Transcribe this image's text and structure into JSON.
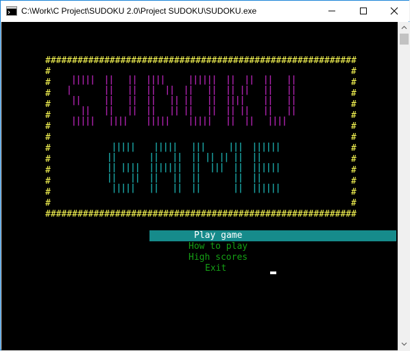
{
  "window": {
    "title": "C:\\Work\\C Project\\SUDOKU 2.0\\Project SUDOKU\\SUDOKU.exe",
    "icons": {
      "app": "console-app-icon",
      "minimize": "minimize-icon",
      "maximize": "maximize-icon",
      "close": "close-icon"
    }
  },
  "frame": {
    "top": "##########################################################",
    "bottom": "##########################################################",
    "side_char": "#",
    "side_count": 13
  },
  "art": {
    "sudoku": " |||||  ||   ||  ||||     ||||||  ||  ||  ||   ||\n|       ||   ||  ||  ||  ||   ||  || ||   ||   ||\n ||     ||   ||  ||   || ||   ||  ||||    ||   ||\n   ||   ||   ||  ||   || ||   ||  || ||   ||   ||\n |||||   ||||    |||||    |||||   ||  ||   ||||",
    "game": "  |||||    |||||   |||     |||  ||||||\n ||       ||   ||  || || || ||  ||\n || ||||  |||||||  ||  |||  ||  ||||||\n ||   ||  ||   ||  ||       ||  ||\n  |||||   ||   ||  ||       ||  ||||||"
  },
  "menu": {
    "items": [
      "Play game",
      "How to play",
      "High scores",
      "Exit"
    ],
    "selected_index": 0
  },
  "colors": {
    "console_bg": "#000000",
    "frame": "#ffff55",
    "sudoku_art": "#aa22aa",
    "game_art": "#1aa3a3",
    "highlight": "#168b8b",
    "menu_text": "#15a015"
  }
}
